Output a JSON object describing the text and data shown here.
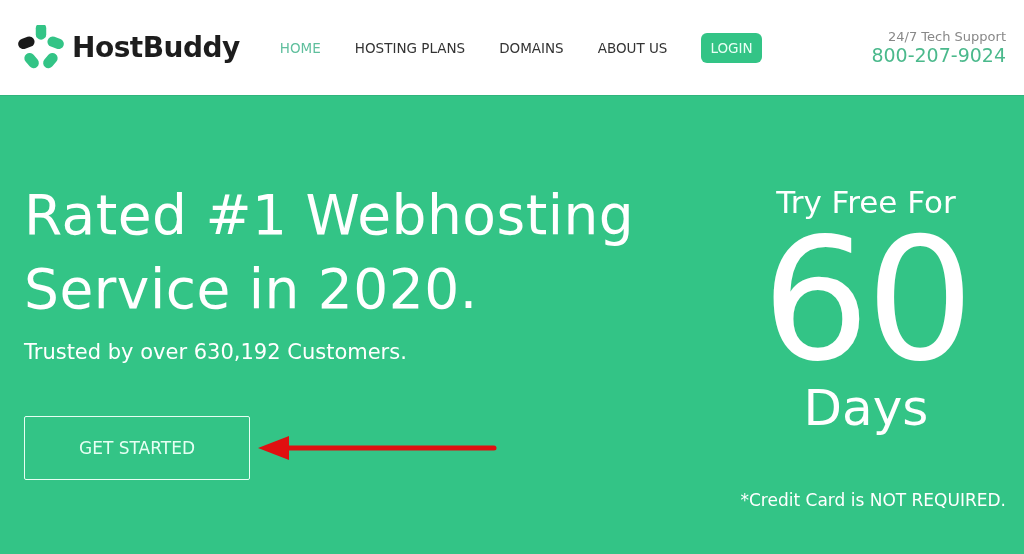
{
  "header": {
    "brand": "HostBuddy",
    "nav": [
      {
        "label": "HOME",
        "selected": true,
        "kind": "link"
      },
      {
        "label": "HOSTING PLANS",
        "selected": false,
        "kind": "link"
      },
      {
        "label": "DOMAINS",
        "selected": false,
        "kind": "link"
      },
      {
        "label": "ABOUT US",
        "selected": false,
        "kind": "link"
      },
      {
        "label": "LOGIN",
        "selected": false,
        "kind": "button"
      }
    ],
    "support": {
      "label": "24/7 Tech Support",
      "phone": "800-207-9024"
    }
  },
  "hero": {
    "headline": [
      "Rated #1 Webhosting",
      "Service in 2020."
    ],
    "subtitle": "Trusted by over 630,192 Customers.",
    "cta": "GET STARTED",
    "offer": {
      "line_1": "Try Free For",
      "number": "60",
      "line_2": "Days",
      "note": "*Credit Card is NOT REQUIRED."
    }
  }
}
